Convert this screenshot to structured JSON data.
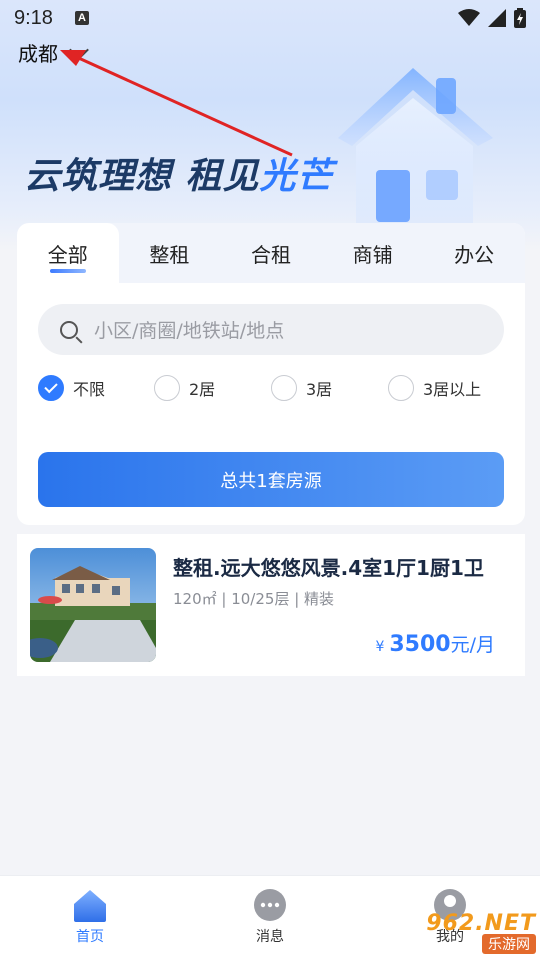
{
  "status_bar": {
    "time": "9:18",
    "notif_icon": "A"
  },
  "header": {
    "city": "成都",
    "slogan_main": "云筑理想 租见",
    "slogan_accent": "光芒"
  },
  "search_card": {
    "tabs": [
      {
        "label": "全部",
        "active": true
      },
      {
        "label": "整租",
        "active": false
      },
      {
        "label": "合租",
        "active": false
      },
      {
        "label": "商铺",
        "active": false
      },
      {
        "label": "办公",
        "active": false
      }
    ],
    "search_placeholder": "小区/商圈/地铁站/地点",
    "room_options": [
      {
        "label": "不限",
        "checked": true
      },
      {
        "label": "2居",
        "checked": false
      },
      {
        "label": "3居",
        "checked": false
      },
      {
        "label": "3居以上",
        "checked": false
      }
    ],
    "result_button": "总共1套房源"
  },
  "listing": {
    "title": "整租.远大悠悠风景.4室1厅1厨1卫",
    "meta": "120㎡ | 10/25层 | 精装",
    "currency": "¥",
    "price": "3500",
    "price_unit": "元/月"
  },
  "bottom_nav": [
    {
      "label": "首页",
      "icon": "home-icon",
      "active": true
    },
    {
      "label": "消息",
      "icon": "message-icon",
      "active": false
    },
    {
      "label": "我的",
      "icon": "profile-icon",
      "active": false
    }
  ],
  "watermark": {
    "top": "962.NET",
    "bottom": "乐游网"
  },
  "colors": {
    "accent": "#2f7bff",
    "title": "#1b2a44",
    "arrow": "#e02424"
  }
}
